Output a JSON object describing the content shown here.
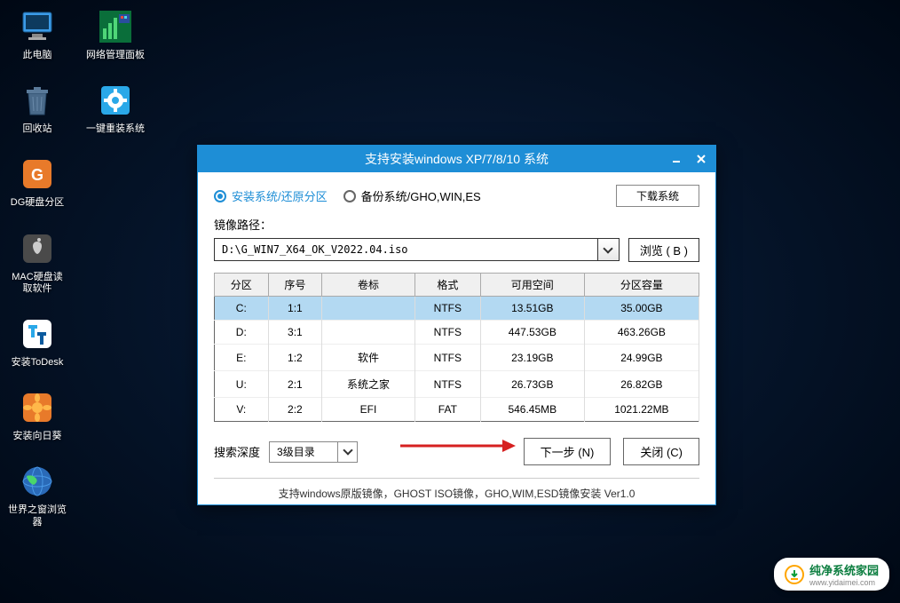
{
  "desktop": {
    "icons": [
      {
        "id": "this-pc",
        "label": "此电脑"
      },
      {
        "id": "net-panel",
        "label": "网络管理面板"
      },
      {
        "id": "recycle-bin",
        "label": "回收站"
      },
      {
        "id": "one-click-reinstall",
        "label": "一键重装系统"
      },
      {
        "id": "dg-partition",
        "label": "DG硬盘分区"
      },
      {
        "id": "mac-disk-read",
        "label": "MAC硬盘读取软件"
      },
      {
        "id": "install-todesk",
        "label": "安装ToDesk"
      },
      {
        "id": "install-sunflower",
        "label": "安装向日葵"
      },
      {
        "id": "world-browser",
        "label": "世界之窗浏览器"
      }
    ]
  },
  "window": {
    "title": "支持安装windows XP/7/8/10 系统",
    "mode_install": "安装系统/还原分区",
    "mode_backup": "备份系统/GHO,WIN,ES",
    "download_btn": "下载系统",
    "path_label": "镜像路径：",
    "path_value": "D:\\G_WIN7_X64_OK_V2022.04.iso",
    "browse_btn": "浏览 ( B )",
    "cols": [
      "分区",
      "序号",
      "卷标",
      "格式",
      "可用空间",
      "分区容量"
    ],
    "rows": [
      {
        "drive": "C:",
        "index": "1:1",
        "label": "",
        "fs": "NTFS",
        "free": "13.51GB",
        "cap": "35.00GB",
        "selected": true
      },
      {
        "drive": "D:",
        "index": "3:1",
        "label": "",
        "fs": "NTFS",
        "free": "447.53GB",
        "cap": "463.26GB",
        "selected": false
      },
      {
        "drive": "E:",
        "index": "1:2",
        "label": "软件",
        "fs": "NTFS",
        "free": "23.19GB",
        "cap": "24.99GB",
        "selected": false
      },
      {
        "drive": "U:",
        "index": "2:1",
        "label": "系统之家",
        "fs": "NTFS",
        "free": "26.73GB",
        "cap": "26.82GB",
        "selected": false
      },
      {
        "drive": "V:",
        "index": "2:2",
        "label": "EFI",
        "fs": "FAT",
        "free": "546.45MB",
        "cap": "1021.22MB",
        "selected": false
      }
    ],
    "depth_label": "搜索深度",
    "depth_value": "3级目录",
    "next_btn": "下一步 (N)",
    "close_btn": "关闭 (C)",
    "footer": "支持windows原版镜像，GHOST ISO镜像，GHO,WIM,ESD镜像安装 Ver1.0"
  },
  "watermark": {
    "title": "纯净系统家园",
    "sub": "www.yidaimei.com"
  }
}
